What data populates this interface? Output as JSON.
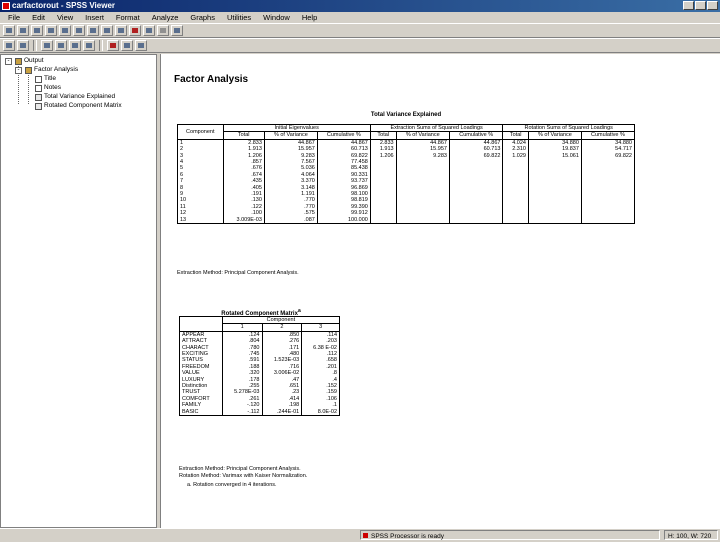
{
  "window": {
    "title": "carfactorout - SPSS Viewer"
  },
  "menu": [
    "File",
    "Edit",
    "View",
    "Insert",
    "Format",
    "Analyze",
    "Graphs",
    "Utilities",
    "Window",
    "Help"
  ],
  "outline": {
    "root": "Output",
    "group": "Factor Analysis",
    "items": [
      "Title",
      "Notes",
      "Total Variance Explained",
      "Rotated Component Matrix"
    ]
  },
  "content": {
    "heading": "Factor Analysis",
    "tve": {
      "title": "Total Variance Explained",
      "component_header": "Component",
      "group_headers": [
        "Initial Eigenvalues",
        "Extraction Sums of Squared Loadings",
        "Rotation Sums of Squared Loadings"
      ],
      "sub_headers": [
        "Total",
        "% of Variance",
        "Cumulative %",
        "Total",
        "% of Variance",
        "Cumulative %",
        "Total",
        "% of Variance",
        "Cumulative %"
      ],
      "rows": [
        [
          "1",
          "2.833",
          "44.867",
          "44.867",
          "2.833",
          "44.867",
          "44.867",
          "4.024",
          "34.880",
          "34.880"
        ],
        [
          "2",
          "1.913",
          "15.957",
          "60.713",
          "1.913",
          "15.957",
          "60.713",
          "2.310",
          "19.837",
          "54.717"
        ],
        [
          "3",
          "1.206",
          "9.283",
          "69.822",
          "1.206",
          "9.283",
          "69.822",
          "1.029",
          "15.061",
          "69.822"
        ],
        [
          "4",
          ".857",
          "7.567",
          "77.458",
          "",
          "",
          "",
          "",
          "",
          ""
        ],
        [
          "5",
          ".676",
          "5.036",
          "85.438",
          "",
          "",
          "",
          "",
          "",
          ""
        ],
        [
          "6",
          ".674",
          "4.064",
          "90.331",
          "",
          "",
          "",
          "",
          "",
          ""
        ],
        [
          "7",
          ".435",
          "3.370",
          "93.737",
          "",
          "",
          "",
          "",
          "",
          ""
        ],
        [
          "8",
          ".405",
          "3.148",
          "96.869",
          "",
          "",
          "",
          "",
          "",
          ""
        ],
        [
          "9",
          ".191",
          "1.191",
          "98.100",
          "",
          "",
          "",
          "",
          "",
          ""
        ],
        [
          "10",
          ".130",
          ".770",
          "98.819",
          "",
          "",
          "",
          "",
          "",
          ""
        ],
        [
          "11",
          ".122",
          ".770",
          "99.390",
          "",
          "",
          "",
          "",
          "",
          ""
        ],
        [
          "12",
          ".100",
          ".575",
          "99.912",
          "",
          "",
          "",
          "",
          "",
          ""
        ],
        [
          "13",
          "3.009E-03",
          ".087",
          "100.000",
          "",
          "",
          "",
          "",
          "",
          ""
        ]
      ],
      "footnote": "Extraction Method: Principal Component Analysis."
    },
    "rcm": {
      "title": "Rotated Component Matrix",
      "title_mark": "a",
      "group_header": "Component",
      "col_headers": [
        "1",
        "2",
        "3"
      ],
      "rows": [
        [
          "APPEAR",
          ".124",
          ".850",
          ".114"
        ],
        [
          "ATTRACT",
          ".804",
          ".276",
          ".203"
        ],
        [
          "CHARACT",
          ".780",
          ".171",
          "6.38 E-02"
        ],
        [
          "EXCITING",
          ".745",
          ".480",
          ".112"
        ],
        [
          "STATUS",
          ".591",
          "1.523E-03",
          ".658"
        ],
        [
          "FREEDOM",
          ".188",
          ".716",
          ".201"
        ],
        [
          "VALUE",
          ".320",
          "3.006E-02",
          ".8"
        ],
        [
          "LUXURY",
          ".178",
          ".47",
          ".4"
        ],
        [
          "Distinction",
          ".255",
          ".651",
          ".152"
        ],
        [
          "TRUST",
          "5.278E-03",
          ".23",
          ".159"
        ],
        [
          "COMFORT",
          ".261",
          ".414",
          ".106"
        ],
        [
          "FAMILY",
          "-.120",
          ".198",
          ".1"
        ],
        [
          "BASIC",
          "-.112",
          ".244E-01",
          "8.0E-02"
        ]
      ],
      "footnotes": [
        "Extraction Method: Principal Component Analysis.",
        "Rotation Method: Varimax with Kaiser Normalization.",
        "a. Rotation converged in 4 iterations."
      ]
    }
  },
  "status": {
    "main": "SPSS Processor is ready",
    "pos": "H: 100, W: 720"
  }
}
